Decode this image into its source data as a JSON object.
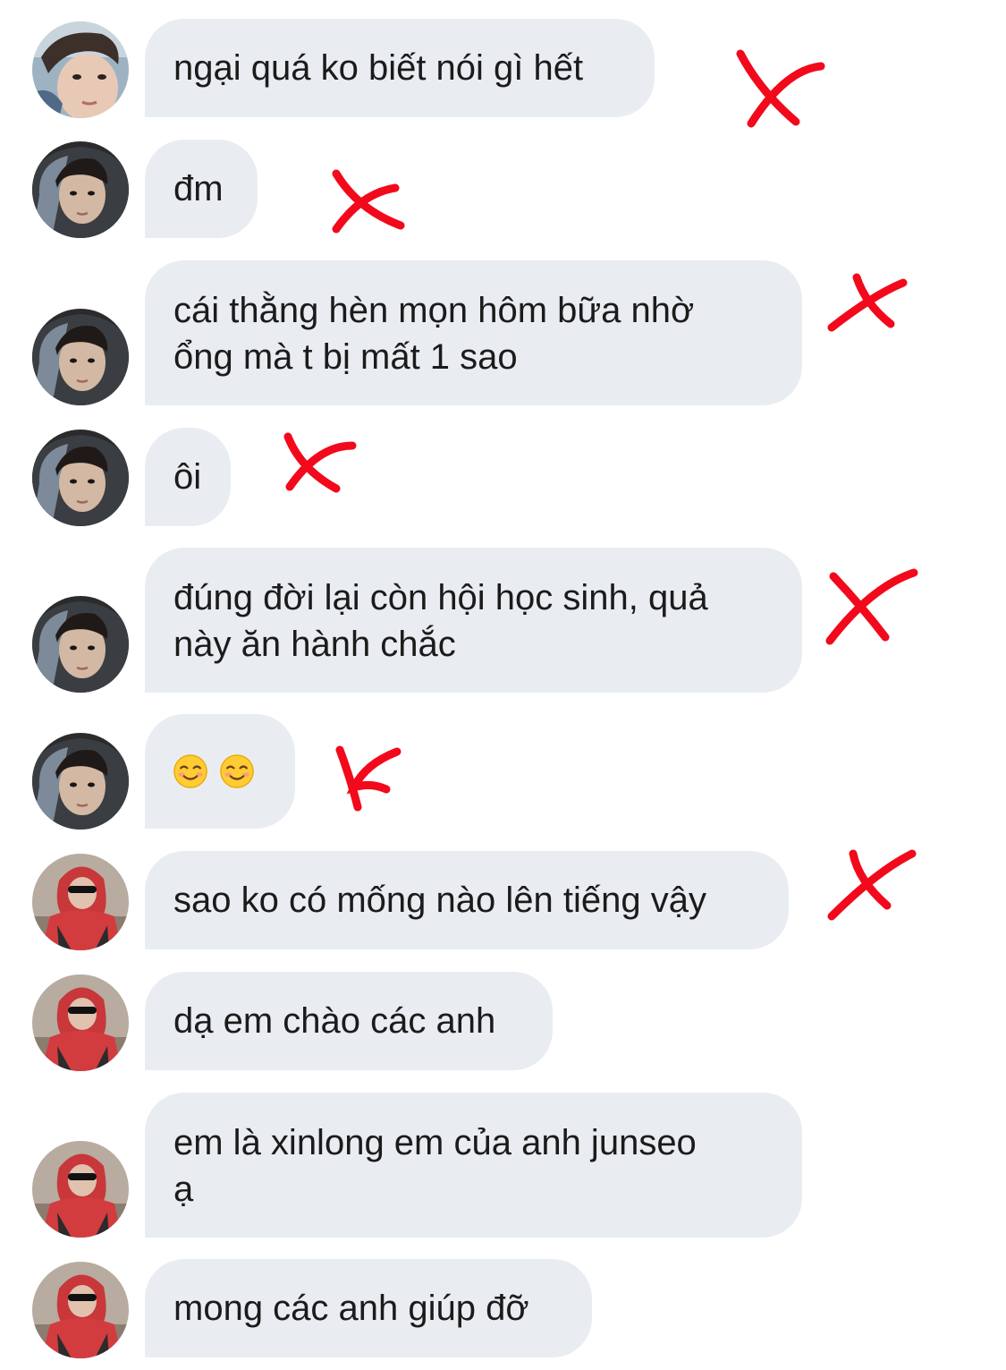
{
  "conversation": {
    "messages": [
      {
        "sender_avatar": "avatar-light-hair-icon",
        "text": "ngại quá ko biết nói gì hết",
        "marked": true
      },
      {
        "sender_avatar": "avatar-dark-hood-icon",
        "text": "đm",
        "marked": true
      },
      {
        "sender_avatar": "avatar-dark-hood-icon",
        "text": "cái thằng hèn mọn hôm bữa nhờ\nổng mà t bị mất 1 sao",
        "marked": true
      },
      {
        "sender_avatar": "avatar-dark-hood-icon",
        "text": "ôi",
        "marked": true
      },
      {
        "sender_avatar": "avatar-dark-hood-icon",
        "text": "đúng đời lại còn hội học sinh, quả\nnày ăn hành chắc",
        "marked": true
      },
      {
        "sender_avatar": "avatar-dark-hood-icon",
        "emojis": [
          "smiling-face-icon",
          "smiling-face-icon"
        ],
        "marked": true
      },
      {
        "sender_avatar": "avatar-red-hoodie-icon",
        "text": "sao ko có mống nào lên tiếng vậy",
        "marked": true
      },
      {
        "sender_avatar": "avatar-red-hoodie-icon",
        "text": "dạ em chào các anh",
        "marked": false
      },
      {
        "sender_avatar": "avatar-red-hoodie-icon",
        "text": "em là xinlong em của anh junseo\nạ",
        "marked": false
      },
      {
        "sender_avatar": "avatar-red-hoodie-icon",
        "text": "mong các anh giúp đỡ",
        "marked": false
      }
    ]
  },
  "colors": {
    "bubble": "#e9edf1",
    "text": "#1b1b1b",
    "mark": "#f2091b"
  }
}
